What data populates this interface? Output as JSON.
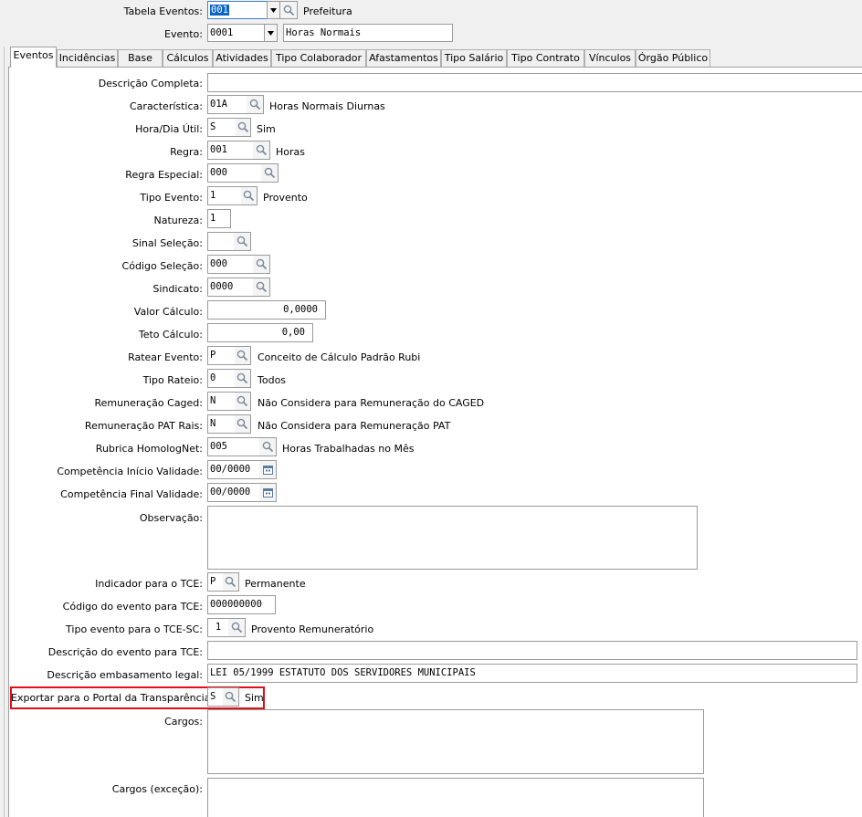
{
  "header": {
    "tabela_label": "Tabela Eventos:",
    "tabela_value": "001",
    "tabela_desc": "Prefeitura",
    "evento_label": "Evento:",
    "evento_value": "0001",
    "evento_desc": "Horas Normais"
  },
  "tabs": [
    "Eventos",
    "Incidências",
    "Base",
    "Cálculos",
    "Atividades",
    "Tipo Colaborador",
    "Afastamentos",
    "Tipo Salário",
    "Tipo Contrato",
    "Vínculos",
    "Órgão Público"
  ],
  "form": {
    "descricao_completa": {
      "label": "Descrição Completa:",
      "value": ""
    },
    "caracteristica": {
      "label": "Característica:",
      "value": "01A",
      "desc": "Horas Normais Diurnas"
    },
    "hora_dia_util": {
      "label": "Hora/Dia Útil:",
      "value": "S",
      "desc": "Sim"
    },
    "regra": {
      "label": "Regra:",
      "value": "001",
      "desc": "Horas"
    },
    "regra_especial": {
      "label": "Regra Especial:",
      "value": "000"
    },
    "tipo_evento": {
      "label": "Tipo Evento:",
      "value": "1",
      "desc": "Provento"
    },
    "natureza": {
      "label": "Natureza:",
      "value": "1"
    },
    "sinal_selecao": {
      "label": "Sinal Seleção:",
      "value": ""
    },
    "codigo_selecao": {
      "label": "Código Seleção:",
      "value": "000"
    },
    "sindicato": {
      "label": "Sindicato:",
      "value": "0000"
    },
    "valor_calculo": {
      "label": "Valor Cálculo:",
      "value": "0,0000"
    },
    "teto_calculo": {
      "label": "Teto Cálculo:",
      "value": "0,00"
    },
    "ratear_evento": {
      "label": "Ratear Evento:",
      "value": "P",
      "desc": "Conceito de Cálculo Padrão Rubi"
    },
    "tipo_rateio": {
      "label": "Tipo Rateio:",
      "value": "0",
      "desc": "Todos"
    },
    "remuneracao_caged": {
      "label": "Remuneração Caged:",
      "value": "N",
      "desc": "Não Considera para Remuneração do CAGED"
    },
    "remuneracao_pat": {
      "label": "Remuneração PAT Rais:",
      "value": "N",
      "desc": "Não Considera para Remuneração PAT"
    },
    "rubrica_homolognet": {
      "label": "Rubrica HomologNet:",
      "value": "005",
      "desc": "Horas Trabalhadas no Mês"
    },
    "competencia_inicio": {
      "label": "Competência Início Validade:",
      "value": "00/0000"
    },
    "competencia_final": {
      "label": "Competência Final Validade:",
      "value": "00/0000"
    },
    "observacao": {
      "label": "Observação:",
      "value": ""
    },
    "indicador_tce": {
      "label": "Indicador para o TCE:",
      "value": "P",
      "desc": "Permanente"
    },
    "codigo_evento_tce": {
      "label": "Código do evento para TCE:",
      "value": "000000000"
    },
    "tipo_evento_tce_sc": {
      "label": "Tipo evento para o TCE-SC:",
      "value": "1",
      "desc": "Provento Remuneratório"
    },
    "descricao_evento_tce": {
      "label": "Descrição do evento para TCE:",
      "value": ""
    },
    "descricao_embasamento": {
      "label": "Descrição embasamento legal:",
      "value": "LEI 05/1999 ESTATUTO DOS SERVIDORES MUNICIPAIS"
    },
    "exportar_portal": {
      "label": "Exportar para o Portal da Transparência:",
      "value": "S",
      "desc": "Sim"
    },
    "cargos": {
      "label": "Cargos:",
      "value": ""
    },
    "cargos_excecao": {
      "label": "Cargos (exceção):",
      "value": ""
    }
  },
  "colors": {
    "highlight": "#e0101a",
    "selection": "#0a64c8"
  }
}
